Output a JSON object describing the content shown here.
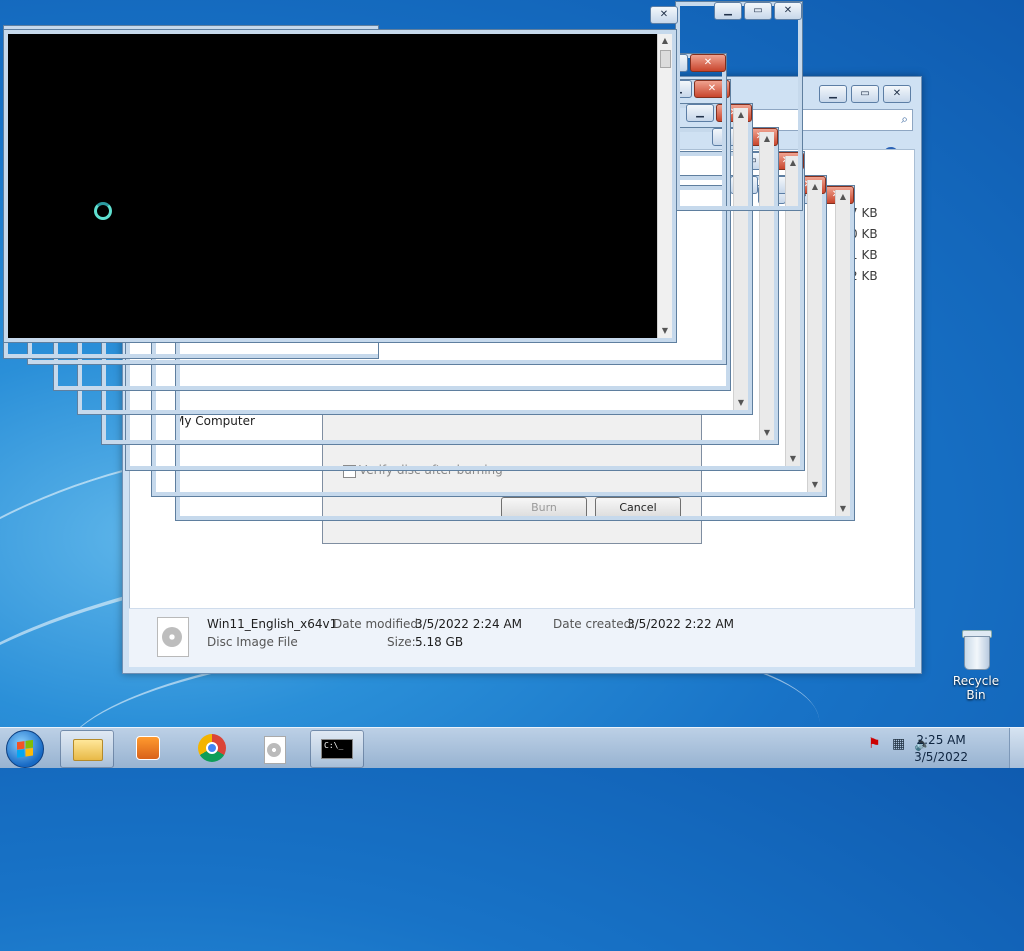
{
  "colors": {
    "desktop": "#1873c7",
    "close_red": "#c8452d",
    "console_bg": "#000000",
    "spinner": "#5fe0d0"
  },
  "explorer": {
    "search_icon": "search-icon",
    "help_icon": "help-icon",
    "file_sizes": [
      "7 KB",
      "0 KB",
      "1 KB",
      "2 KB"
    ],
    "tree_item": "My Computer",
    "details": {
      "file_name": "Win11_English_x64v1",
      "file_type": "Disc Image File",
      "date_modified_label": "Date modified:",
      "date_modified_value": "3/5/2022 2:24 AM",
      "size_label": "Size:",
      "size_value": "5.18 GB",
      "date_created_label": "Date created:",
      "date_created_value": "3/5/2022 2:22 AM"
    }
  },
  "burn_dialog": {
    "verify_label": "Verify disc after burning",
    "burn_button": "Burn",
    "cancel_button": "Cancel"
  },
  "desktop": {
    "recycle_bin_label": "Recycle Bin"
  },
  "taskbar": {
    "start_icon": "windows-start-icon",
    "pinned": [
      {
        "name": "explorer-taskbar-button",
        "icon": "folder-icon"
      },
      {
        "name": "media-player-taskbar-button",
        "icon": "media-player-icon"
      },
      {
        "name": "chrome-taskbar-button",
        "icon": "chrome-icon"
      },
      {
        "name": "disc-burner-taskbar-button",
        "icon": "disc-image-icon"
      },
      {
        "name": "cmd-taskbar-button",
        "icon": "command-prompt-icon",
        "label": "C:\\_"
      }
    ],
    "tray_icons": [
      "action-center-flag-icon",
      "network-icon",
      "volume-icon"
    ],
    "clock_time": "2:25 AM",
    "clock_date": "3/5/2022"
  }
}
